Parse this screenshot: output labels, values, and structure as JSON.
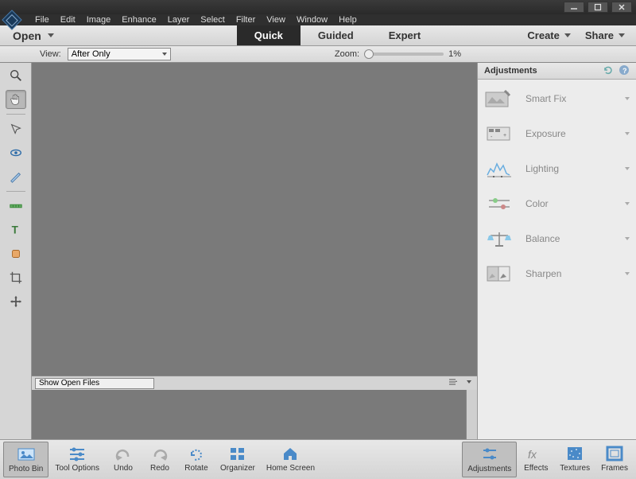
{
  "menubar": [
    "File",
    "Edit",
    "Image",
    "Enhance",
    "Layer",
    "Select",
    "Filter",
    "View",
    "Window",
    "Help"
  ],
  "modebar": {
    "open_label": "Open",
    "tabs": [
      "Quick",
      "Guided",
      "Expert"
    ],
    "active_tab": 0,
    "create_label": "Create",
    "share_label": "Share"
  },
  "optionsbar": {
    "view_label": "View:",
    "view_value": "After Only",
    "zoom_label": "Zoom:",
    "zoom_value": "1%"
  },
  "tools": [
    {
      "name": "zoom-tool",
      "selected": false
    },
    {
      "name": "hand-tool",
      "selected": true
    },
    {
      "name": "quick-select-tool",
      "selected": false
    },
    {
      "name": "eye-tool",
      "selected": false
    },
    {
      "name": "whiten-teeth-tool",
      "selected": false
    },
    {
      "name": "straighten-tool",
      "selected": false
    },
    {
      "name": "type-tool",
      "selected": false
    },
    {
      "name": "spot-heal-tool",
      "selected": false
    },
    {
      "name": "crop-tool",
      "selected": false
    },
    {
      "name": "move-tool",
      "selected": false
    }
  ],
  "panel": {
    "title": "Adjustments",
    "items": [
      {
        "name": "smart-fix",
        "label": "Smart Fix"
      },
      {
        "name": "exposure",
        "label": "Exposure"
      },
      {
        "name": "lighting",
        "label": "Lighting"
      },
      {
        "name": "color",
        "label": "Color"
      },
      {
        "name": "balance",
        "label": "Balance"
      },
      {
        "name": "sharpen",
        "label": "Sharpen"
      }
    ]
  },
  "photobin": {
    "dropdown_value": "Show Open Files"
  },
  "bottombar": {
    "left": [
      {
        "name": "photo-bin",
        "label": "Photo Bin",
        "selected": true
      },
      {
        "name": "tool-options",
        "label": "Tool Options",
        "selected": false
      },
      {
        "name": "undo",
        "label": "Undo",
        "selected": false
      },
      {
        "name": "redo",
        "label": "Redo",
        "selected": false
      },
      {
        "name": "rotate",
        "label": "Rotate",
        "selected": false
      },
      {
        "name": "organizer",
        "label": "Organizer",
        "selected": false
      },
      {
        "name": "home-screen",
        "label": "Home Screen",
        "selected": false
      }
    ],
    "right": [
      {
        "name": "adjustments",
        "label": "Adjustments",
        "selected": true
      },
      {
        "name": "effects",
        "label": "Effects",
        "selected": false
      },
      {
        "name": "textures",
        "label": "Textures",
        "selected": false
      },
      {
        "name": "frames",
        "label": "Frames",
        "selected": false
      }
    ]
  }
}
